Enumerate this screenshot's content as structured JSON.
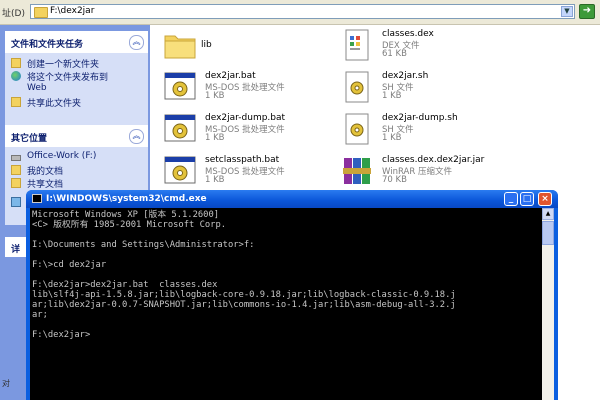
{
  "address_bar": {
    "label": "址(D)",
    "path": "F:\\dex2jar",
    "go_icon": "go-arrow-icon"
  },
  "task_pane": {
    "file_tasks": {
      "title": "文件和文件夹任务",
      "items": [
        {
          "label": "创建一个新文件夹",
          "icon": "new-folder-icon"
        },
        {
          "label": "将这个文件夹发布到",
          "icon": "publish-web-icon"
        },
        {
          "label": "Web",
          "icon": ""
        },
        {
          "label": "共享此文件夹",
          "icon": "share-folder-icon"
        }
      ]
    },
    "other_places": {
      "title": "其它位置",
      "items": [
        {
          "label": "Office-Work (F:)",
          "icon": "drive-icon"
        },
        {
          "label": "我的文档",
          "icon": "my-documents-icon"
        },
        {
          "label": "共享文档",
          "icon": "shared-docs-icon"
        }
      ]
    },
    "details_stub": "详"
  },
  "files": [
    {
      "name": "lib",
      "type": "",
      "size": "",
      "icon": "folder-icon"
    },
    {
      "name": "classes.dex",
      "type": "DEX 文件",
      "size": "61 KB",
      "icon": "dex-file-icon"
    },
    {
      "name": "dex2jar.bat",
      "type": "MS-DOS 批处理文件",
      "size": "1 KB",
      "icon": "batch-file-icon"
    },
    {
      "name": "dex2jar.sh",
      "type": "SH 文件",
      "size": "1 KB",
      "icon": "sh-file-icon"
    },
    {
      "name": "dex2jar-dump.bat",
      "type": "MS-DOS 批处理文件",
      "size": "1 KB",
      "icon": "batch-file-icon"
    },
    {
      "name": "dex2jar-dump.sh",
      "type": "SH 文件",
      "size": "1 KB",
      "icon": "sh-file-icon"
    },
    {
      "name": "setclasspath.bat",
      "type": "MS-DOS 批处理文件",
      "size": "1 KB",
      "icon": "batch-file-icon"
    },
    {
      "name": "classes.dex.dex2jar.jar",
      "type": "WinRAR 压缩文件",
      "size": "70 KB",
      "icon": "winrar-icon"
    }
  ],
  "cmd": {
    "title": "I:\\WINDOWS\\system32\\cmd.exe",
    "lines": [
      "Microsoft Windows XP [版本 5.1.2600]",
      "<C> 版权所有 1985-2001 Microsoft Corp.",
      "",
      "I:\\Documents and Settings\\Administrator>f:",
      "",
      "F:\\>cd dex2jar",
      "",
      "F:\\dex2jar>dex2jar.bat  classes.dex",
      "lib\\slf4j-api-1.5.8.jar;lib\\logback-core-0.9.18.jar;lib\\logback-classic-0.9.18.j",
      "ar;lib\\dex2jar-0.0.7-SNAPSHOT.jar;lib\\commons-io-1.4.jar;lib\\asm-debug-all-3.2.j",
      "ar;",
      "",
      "F:\\dex2jar>"
    ],
    "minimize": "_",
    "maximize": "□",
    "close": "×"
  },
  "status": {
    "left": "对",
    "right": ""
  }
}
